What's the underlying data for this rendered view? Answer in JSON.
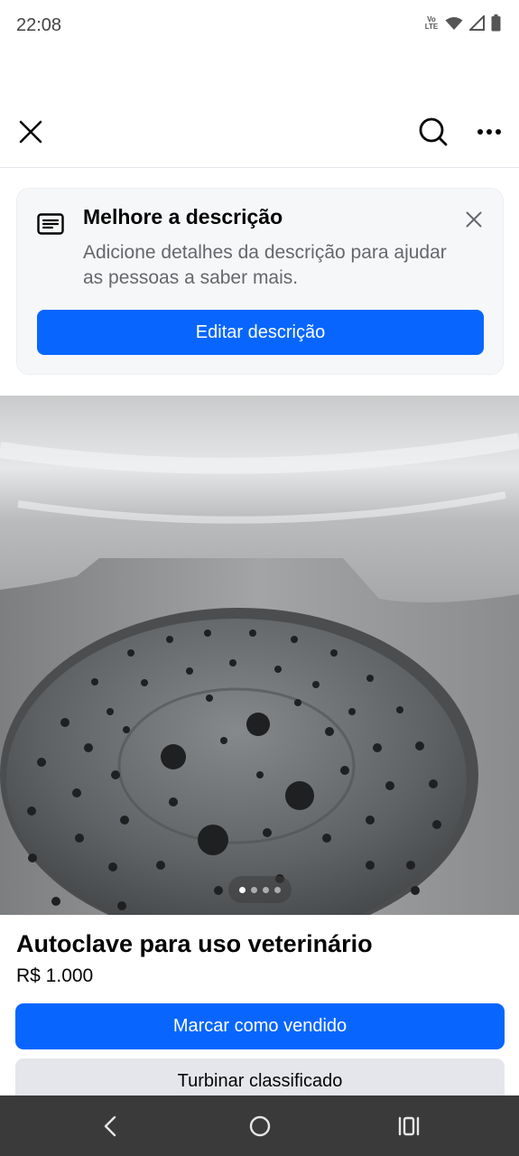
{
  "status_bar": {
    "time": "22:08",
    "network_label": "Vo LTE",
    "icons": [
      "volte-icon",
      "wifi-icon",
      "signal-icon",
      "battery-icon"
    ]
  },
  "top_nav": {
    "icons": [
      "close-icon",
      "search-icon",
      "more-icon"
    ]
  },
  "description_card": {
    "icon": "document-icon",
    "title": "Melhore a descrição",
    "text": "Adicione detalhes da descrição para ajudar as pessoas a saber mais.",
    "button_label": "Editar descrição",
    "dismiss_icon": "close-icon"
  },
  "product": {
    "image_alt": "autoclave-interior-photo",
    "carousel": {
      "total": 4,
      "active_index": 0
    },
    "title": "Autoclave para uso veterinário",
    "price": "R$ 1.000"
  },
  "actions": {
    "mark_sold_label": "Marcar como vendido",
    "boost_label": "Turbinar classificado"
  },
  "system_nav": {
    "icons": [
      "back-icon",
      "home-icon",
      "recents-icon"
    ]
  },
  "colors": {
    "primary": "#0866ff",
    "secondary_button": "#e4e6eb",
    "card_bg": "#f6f7f9",
    "muted_text": "#65676b",
    "system_nav_bg": "#3a3a3a"
  }
}
